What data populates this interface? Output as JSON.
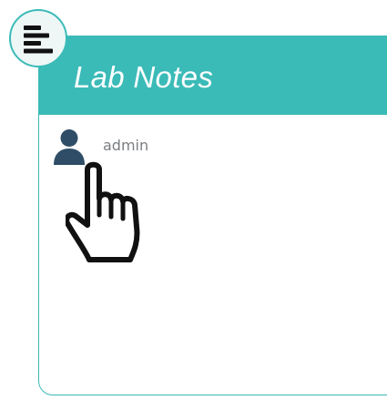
{
  "panel": {
    "title": "Lab Notes"
  },
  "user": {
    "name": "admin",
    "icon": "user-icon"
  },
  "menu": {
    "icon": "hamburger-menu-icon"
  },
  "cursor": {
    "icon": "hand-pointer-cursor"
  },
  "colors": {
    "accent": "#3bbbb8",
    "title_text": "#ffffff",
    "user_icon": "#2f4d66",
    "user_text": "#7b7f83",
    "menu_background": "#eef7f6"
  }
}
